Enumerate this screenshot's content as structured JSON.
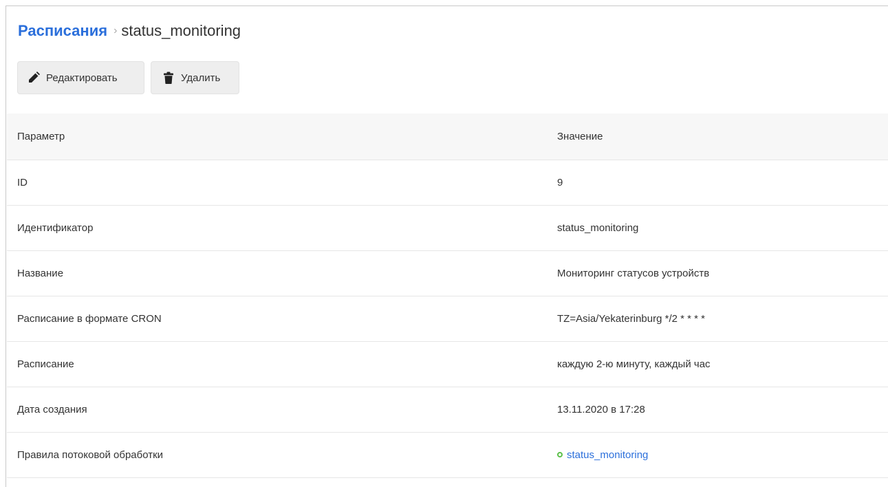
{
  "breadcrumb": {
    "parent": "Расписания",
    "separator": "›",
    "current": "status_monitoring"
  },
  "toolbar": {
    "edit_label": "Редактировать",
    "delete_label": "Удалить",
    "edit_icon": "pencil-icon",
    "delete_icon": "trash-icon"
  },
  "table": {
    "headers": [
      "Параметр",
      "Значение"
    ],
    "rows": [
      {
        "param": "ID",
        "value": "9"
      },
      {
        "param": "Идентификатор",
        "value": "status_monitoring"
      },
      {
        "param": "Название",
        "value": "Мониторинг статусов устройств"
      },
      {
        "param": "Расписание в формате CRON",
        "value": "TZ=Asia/Yekaterinburg */2 * * * *"
      },
      {
        "param": "Расписание",
        "value": "каждую 2-ю минуту, каждый час"
      },
      {
        "param": "Дата создания",
        "value": "13.11.2020 в 17:28"
      },
      {
        "param": "Правила потоковой обработки",
        "value": "status_monitoring"
      }
    ]
  },
  "colors": {
    "link": "#2b6fdb",
    "status_ok": "#5cc04a",
    "header_bg": "#f7f7f7"
  }
}
